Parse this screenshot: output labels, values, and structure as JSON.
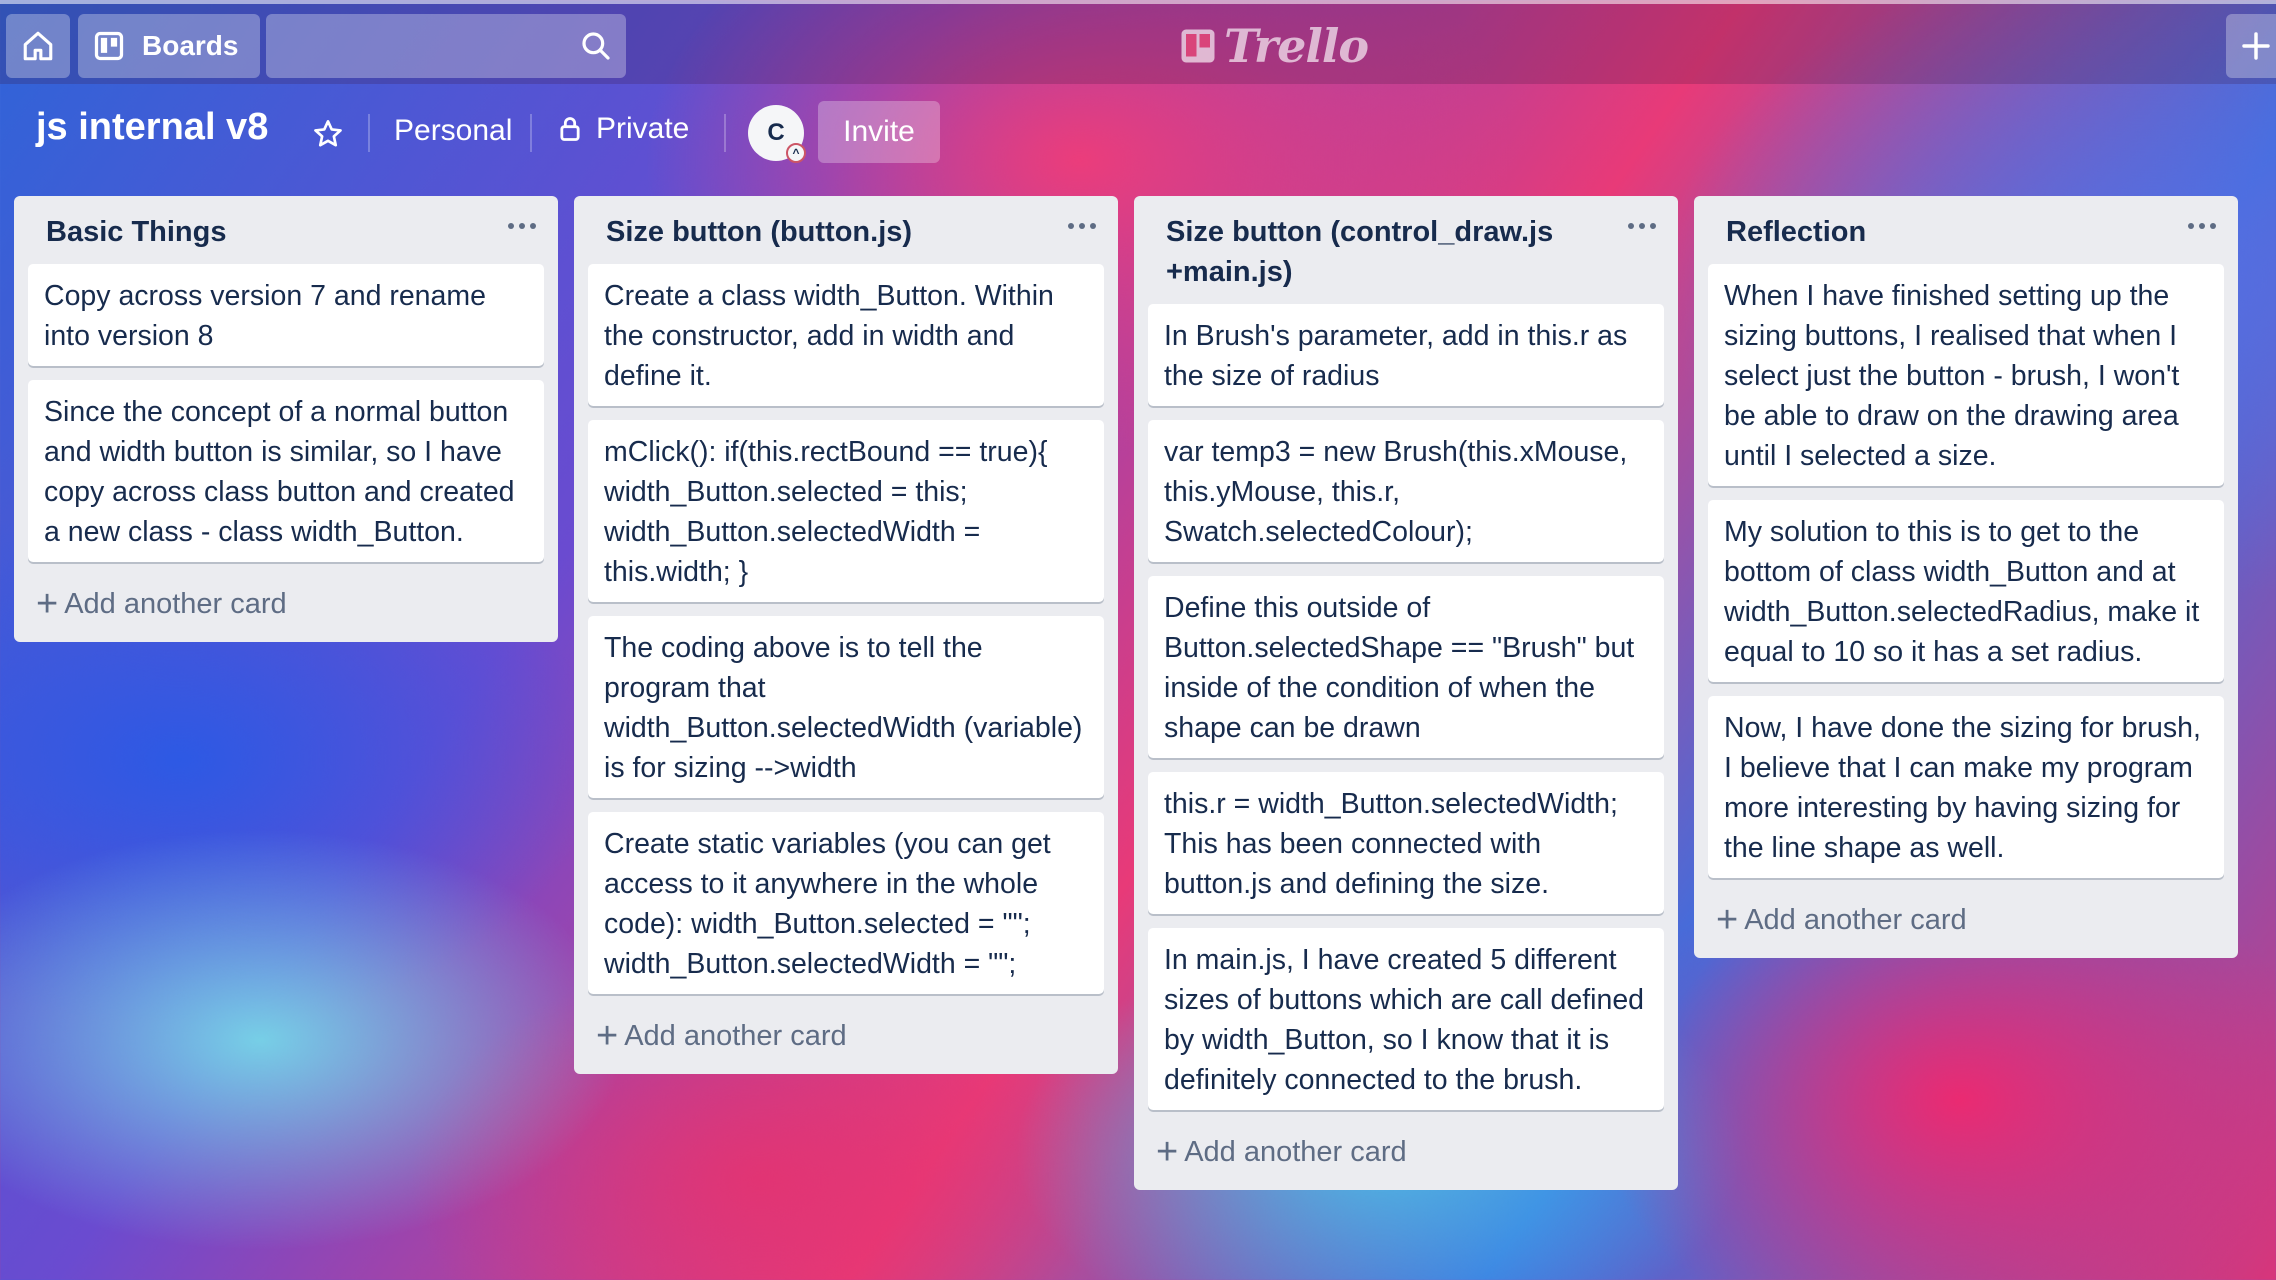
{
  "header": {
    "boards_label": "Boards",
    "logo_text": "Trello",
    "home_icon": "home-icon",
    "search_icon": "search-icon",
    "add_icon": "plus-icon"
  },
  "board": {
    "title": "js internal v8",
    "visibility_team": "Personal",
    "visibility_privacy": "Private",
    "member_initial": "C",
    "invite_label": "Invite"
  },
  "lists": [
    {
      "title": "Basic Things",
      "cards": [
        "Copy across version 7 and rename into version 8",
        "Since the concept of a normal button and width button is similar, so I have copy across class button and created a new class - class width_Button."
      ],
      "add_label": "Add another card"
    },
    {
      "title": "Size button (button.js)",
      "cards": [
        "Create a class width_Button. Within the constructor, add in width and define it.",
        "mClick(): if(this.rectBound == true){ width_Button.selected = this; width_Button.selectedWidth = this.width; }",
        "The coding above is to tell the program that width_Button.selectedWidth (variable) is for sizing -->width",
        "Create static variables (you can get access to it anywhere in the whole code): width_Button.selected = \"\"; width_Button.selectedWidth = \"\";"
      ],
      "add_label": "Add another card"
    },
    {
      "title": "Size button (control_draw.js +main.js)",
      "cards": [
        "In Brush's parameter, add in this.r as the size of radius",
        "var temp3 = new Brush(this.xMouse, this.yMouse, this.r, Swatch.selectedColour);",
        "Define this outside of Button.selectedShape == \"Brush\" but inside of the condition of when the shape can be drawn",
        "this.r = width_Button.selectedWidth; This has been connected with button.js and defining the size.",
        "In main.js, I have created 5 different sizes of buttons which are call defined by width_Button, so I know that it is definitely connected to the brush."
      ],
      "add_label": "Add another card"
    },
    {
      "title": "Reflection",
      "cards": [
        "When I have finished setting up the sizing buttons, I realised that when I select just the button - brush, I won't be able to draw on the drawing area until I selected a size.",
        "My solution to this is to get to the bottom of class width_Button and at width_Button.selectedRadius, make it equal to 10 so it has a set radius.",
        "Now, I have done the sizing for brush, I believe that I can make my program more interesting by having sizing for the line shape as well."
      ],
      "add_label": "Add another card"
    }
  ],
  "colors": {
    "list_bg": "#ebecf0",
    "card_text": "#172b4d",
    "muted_text": "#5e6c84"
  }
}
